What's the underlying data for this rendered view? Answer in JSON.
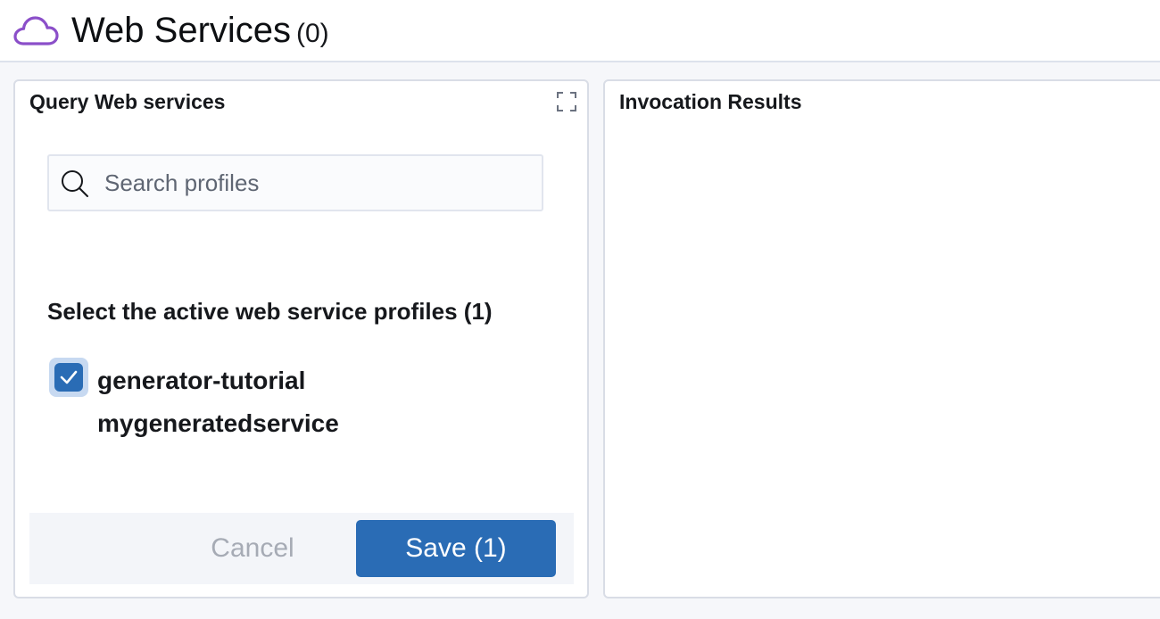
{
  "header": {
    "icon": "cloud-icon",
    "icon_color": "#8b4fc9",
    "title": "Web Services",
    "count": "(0)"
  },
  "query_panel": {
    "title": "Query Web services",
    "expand_icon": "expand-icon",
    "search": {
      "icon": "search-icon",
      "placeholder": "Search profiles",
      "value": ""
    },
    "section_heading": "Select the active web service profiles (1)",
    "profiles": [
      {
        "label_line1": "generator-tutorial",
        "label_line2": "mygeneratedservice",
        "checked": true
      }
    ],
    "cancel_label": "Cancel",
    "save_label": "Save (1)"
  },
  "results_panel": {
    "title": "Invocation Results"
  },
  "colors": {
    "accent": "#2a6cb5",
    "cloud_icon": "#8b4fc9",
    "checkbox_ring": "#c7d9f1",
    "disabled_text": "#a6abb5"
  }
}
